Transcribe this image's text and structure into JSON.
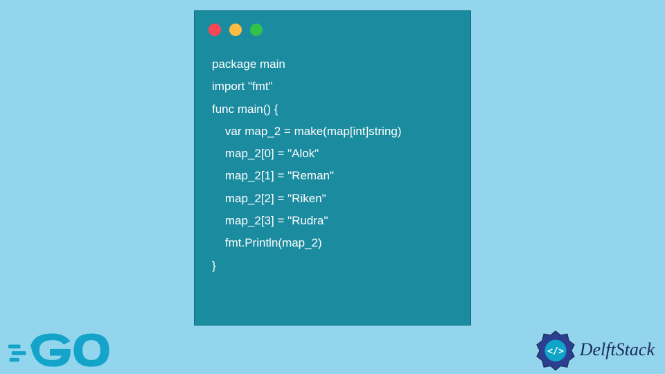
{
  "code": {
    "lines": [
      "package main",
      "",
      "import \"fmt\"",
      "",
      "func main() {",
      "    var map_2 = make(map[int]string)",
      "    map_2[0] = \"Alok\"",
      "    map_2[1] = \"Reman\"",
      "    map_2[2] = \"Riken\"",
      "    map_2[3] = \"Rudra\"",
      "    fmt.Println(map_2)",
      "",
      "}"
    ]
  },
  "logos": {
    "go_text": "GO",
    "delftstack_text": "DelftStack"
  },
  "colors": {
    "background": "#93d5ed",
    "code_window": "#1b8b9f",
    "code_text": "#ffffff",
    "dot_red": "#fa4654",
    "dot_yellow": "#febc41",
    "dot_green": "#31c24a",
    "go_blue": "#14a4c9",
    "delftstack_text_color": "#1b2d5c"
  }
}
